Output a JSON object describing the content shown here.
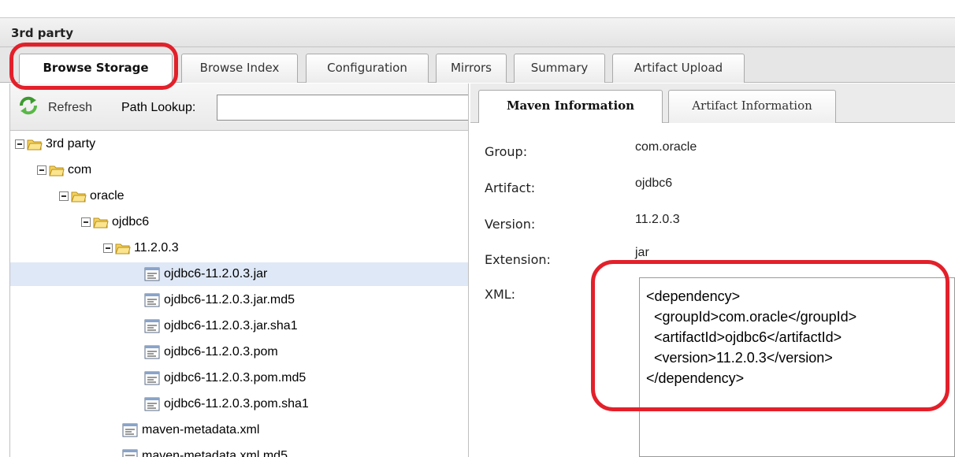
{
  "panel": {
    "title": "3rd party"
  },
  "tabs": [
    {
      "label": "Browse Storage",
      "active": true
    },
    {
      "label": "Browse Index",
      "active": false
    },
    {
      "label": "Configuration",
      "active": false
    },
    {
      "label": "Mirrors",
      "active": false
    },
    {
      "label": "Summary",
      "active": false
    },
    {
      "label": "Artifact Upload",
      "active": false
    }
  ],
  "toolbar": {
    "refresh_label": "Refresh",
    "path_lookup_label": "Path Lookup:",
    "path_lookup_value": "",
    "refresh_icon": "refresh-icon"
  },
  "tree": [
    {
      "label": "3rd party",
      "type": "folder",
      "expanded": true,
      "depth": 0,
      "selected": false
    },
    {
      "label": "com",
      "type": "folder",
      "expanded": true,
      "depth": 1,
      "selected": false
    },
    {
      "label": "oracle",
      "type": "folder",
      "expanded": true,
      "depth": 2,
      "selected": false
    },
    {
      "label": "ojdbc6",
      "type": "folder",
      "expanded": true,
      "depth": 3,
      "selected": false
    },
    {
      "label": "11.2.0.3",
      "type": "folder",
      "expanded": true,
      "depth": 4,
      "selected": false
    },
    {
      "label": "ojdbc6-11.2.0.3.jar",
      "type": "file",
      "depth": 5,
      "selected": true
    },
    {
      "label": "ojdbc6-11.2.0.3.jar.md5",
      "type": "file",
      "depth": 5,
      "selected": false
    },
    {
      "label": "ojdbc6-11.2.0.3.jar.sha1",
      "type": "file",
      "depth": 5,
      "selected": false
    },
    {
      "label": "ojdbc6-11.2.0.3.pom",
      "type": "file",
      "depth": 5,
      "selected": false
    },
    {
      "label": "ojdbc6-11.2.0.3.pom.md5",
      "type": "file",
      "depth": 5,
      "selected": false
    },
    {
      "label": "ojdbc6-11.2.0.3.pom.sha1",
      "type": "file",
      "depth": 5,
      "selected": false
    },
    {
      "label": "maven-metadata.xml",
      "type": "file",
      "depth": 4,
      "selected": false
    },
    {
      "label": "maven-metadata.xml.md5",
      "type": "file",
      "depth": 4,
      "selected": false
    }
  ],
  "detail_tabs": [
    {
      "label": "Maven Information",
      "active": true
    },
    {
      "label": "Artifact Information",
      "active": false
    }
  ],
  "maven_info": {
    "group_label": "Group:",
    "group_value": "com.oracle",
    "artifact_label": "Artifact:",
    "artifact_value": "ojdbc6",
    "version_label": "Version:",
    "version_value": "11.2.0.3",
    "extension_label": "Extension:",
    "extension_value": "jar",
    "xml_label": "XML:",
    "xml_value": "<dependency>\n  <groupId>com.oracle</groupId>\n  <artifactId>ojdbc6</artifactId>\n  <version>11.2.0.3</version>\n</dependency>"
  },
  "colors": {
    "highlight": "#e3202a",
    "selected_row": "#dfe8f6",
    "folder": "#f5d25e"
  }
}
